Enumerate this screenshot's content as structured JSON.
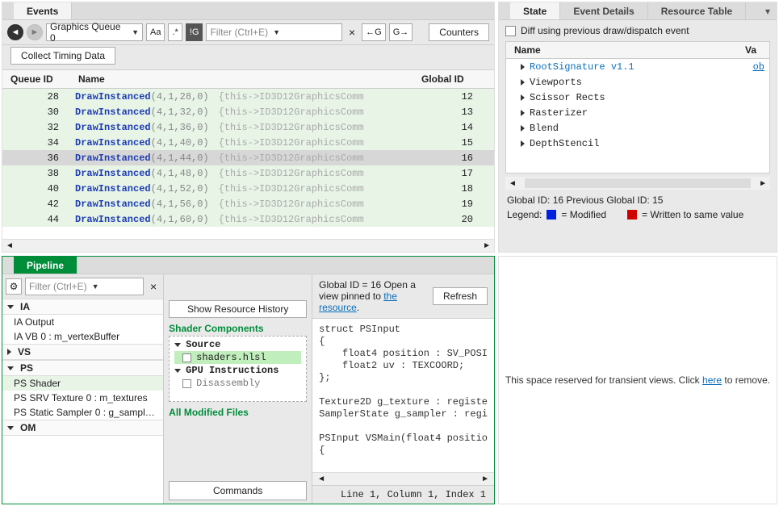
{
  "events": {
    "tab": "Events",
    "toolbar": {
      "queue": "Graphics Queue 0",
      "aa": "Aa",
      "star": ".*",
      "not_g": "!G",
      "filter_placeholder": "Filter (Ctrl+E)",
      "filter_value": "",
      "clear": "×",
      "gprev": "←G",
      "gnext": "G→",
      "counters": "Counters"
    },
    "collect": "Collect Timing Data",
    "columns": {
      "qid": "Queue ID",
      "name": "Name",
      "gid": "Global ID"
    },
    "fn": "DrawInstanced",
    "this": "{this->ID3D12GraphicsComm",
    "rows": [
      {
        "qid": 28,
        "args": "(4,1,28,0)",
        "gid": 12,
        "sel": false
      },
      {
        "qid": 30,
        "args": "(4,1,32,0)",
        "gid": 13,
        "sel": false
      },
      {
        "qid": 32,
        "args": "(4,1,36,0)",
        "gid": 14,
        "sel": false
      },
      {
        "qid": 34,
        "args": "(4,1,40,0)",
        "gid": 15,
        "sel": false
      },
      {
        "qid": 36,
        "args": "(4,1,44,0)",
        "gid": 16,
        "sel": true
      },
      {
        "qid": 38,
        "args": "(4,1,48,0)",
        "gid": 17,
        "sel": false
      },
      {
        "qid": 40,
        "args": "(4,1,52,0)",
        "gid": 18,
        "sel": false
      },
      {
        "qid": 42,
        "args": "(4,1,56,0)",
        "gid": 19,
        "sel": false
      },
      {
        "qid": 44,
        "args": "(4,1,60,0)",
        "gid": 20,
        "sel": false
      }
    ]
  },
  "state": {
    "tabs": {
      "state": "State",
      "details": "Event Details",
      "res": "Resource Table"
    },
    "diff_label": "Diff using previous draw/dispatch event",
    "columns": {
      "name": "Name",
      "value": "Va"
    },
    "root_sig": "RootSignature v1.1",
    "root_val": "ob",
    "items": [
      "Viewports",
      "Scissor Rects",
      "Rasterizer",
      "Blend",
      "DepthStencil"
    ],
    "status": "Global ID: 16  Previous Global ID: 15",
    "legend": "Legend:",
    "legend_mod": "= Modified",
    "legend_same": "= Written to same value"
  },
  "pipeline": {
    "tab": "Pipeline",
    "filter_placeholder": "Filter (Ctrl+E)",
    "gid_text": "Global ID = 16   Open a view pinned to ",
    "gid_link": "the resource",
    "refresh": "Refresh",
    "show_history": "Show Resource History",
    "sections": {
      "ia": "IA",
      "ia_items": [
        "IA Output",
        "IA VB 0 : m_vertexBuffer"
      ],
      "vs": "VS",
      "ps": "PS",
      "ps_items": [
        "PS Shader",
        "PS SRV Texture 0 : m_textures",
        "PS Static Sampler 0 : g_sampl…"
      ],
      "om": "OM"
    },
    "shader_components": "Shader Components",
    "source": "Source",
    "source_file": "shaders.hlsl",
    "gpu_instr": "GPU Instructions",
    "disasm": "Disassembly",
    "all_modified": "All Modified Files",
    "commands": "Commands",
    "code": "struct PSInput\n{\n    float4 position : SV_POSI\n    float2 uv : TEXCOORD;\n};\n\nTexture2D g_texture : registe\nSamplerState g_sampler : regi\n\nPSInput VSMain(float4 positio\n{",
    "cursor": "Line 1, Column 1, Index 1"
  },
  "transient": {
    "pre": "This space reserved for transient views. Click ",
    "link": "here",
    "post": " to remove."
  }
}
